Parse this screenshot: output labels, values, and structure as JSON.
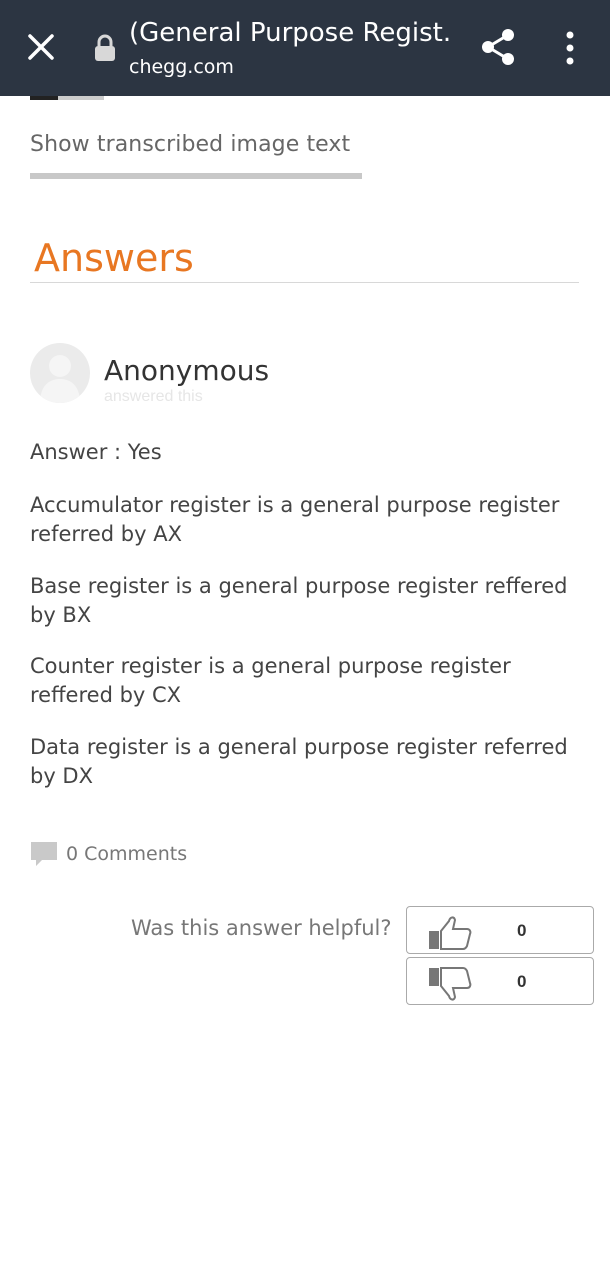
{
  "browser": {
    "title": "(General Purpose Regist...",
    "domain": "chegg.com",
    "icons": {
      "close": "close-icon",
      "lock": "lock-icon",
      "share": "share-icon",
      "menu": "more-vert-icon"
    }
  },
  "content": {
    "show_transcribed_label": "Show transcribed image text",
    "answers_heading": "Answers",
    "accent_color": "#e87722"
  },
  "answer": {
    "author": "Anonymous",
    "answered_label": "answered this",
    "paragraphs": [
      "Answer : Yes",
      "Accumulator register is a general purpose register referred by AX",
      "Base register is a general purpose register reffered by BX",
      "Counter register is a general purpose register reffered by CX",
      "Data register is a general purpose register referred by DX"
    ],
    "comments_label": "0 Comments",
    "helpful_question": "Was this answer helpful?",
    "thumbs_up_count": "0",
    "thumbs_down_count": "0"
  }
}
